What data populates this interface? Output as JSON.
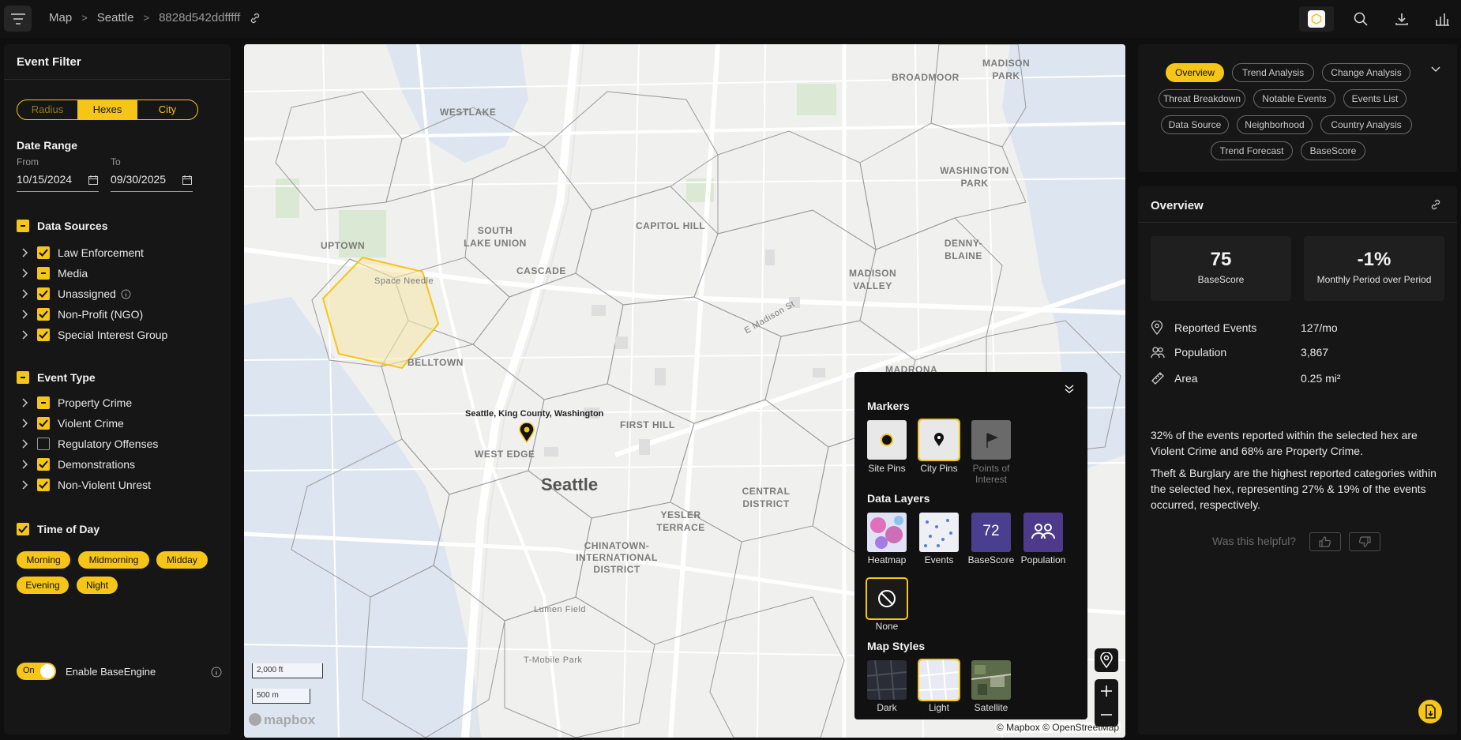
{
  "breadcrumb": {
    "items": [
      "Map",
      "Seattle",
      "8828d542ddfffff"
    ]
  },
  "colors": {
    "accent": "#f5c518",
    "panel": "#161616",
    "background": "#0f0f0f"
  },
  "icons": [
    "filter-icon",
    "link-icon",
    "hex-logo-icon",
    "search-icon",
    "download-icon",
    "chart-icon",
    "calendar-icon",
    "info-icon",
    "pin-icon",
    "zoom-in-icon",
    "zoom-out-icon",
    "export-icon"
  ],
  "event_filter": {
    "title": "Event Filter",
    "modes": [
      "Radius",
      "Hexes",
      "City"
    ],
    "selected_mode": "Hexes",
    "date_range": {
      "label": "Date Range",
      "from_label": "From",
      "from": "10/15/2024",
      "to_label": "To",
      "to": "09/30/2025"
    },
    "data_sources": {
      "label": "Data Sources",
      "items": [
        {
          "label": "Law Enforcement",
          "state": "checked"
        },
        {
          "label": "Media",
          "state": "partial"
        },
        {
          "label": "Unassigned",
          "state": "checked"
        },
        {
          "label": "Non-Profit (NGO)",
          "state": "checked"
        },
        {
          "label": "Special Interest Group",
          "state": "checked"
        }
      ]
    },
    "event_type": {
      "label": "Event Type",
      "items": [
        {
          "label": "Property Crime",
          "state": "partial"
        },
        {
          "label": "Violent Crime",
          "state": "checked"
        },
        {
          "label": "Regulatory Offenses",
          "state": "unchecked"
        },
        {
          "label": "Demonstrations",
          "state": "checked"
        },
        {
          "label": "Non-Violent Unrest",
          "state": "checked"
        }
      ]
    },
    "time_of_day": {
      "label": "Time of Day",
      "pills": [
        "Morning",
        "Midmorning",
        "Midday",
        "Evening",
        "Night"
      ]
    },
    "baseengine": {
      "toggle_text": "On",
      "label": "Enable BaseEngine"
    }
  },
  "map": {
    "place_labels": [
      "WESTLAKE",
      "SOUTH LAKE UNION",
      "UPTOWN",
      "CASCADE",
      "CAPITOL HILL",
      "BELLTOWN",
      "WEST EDGE",
      "FIRST HILL",
      "YESLER TERRACE",
      "CENTRAL DISTRICT",
      "CHINATOWN-INTERNATIONAL DISTRICT",
      "MADISON VALLEY",
      "DENNY-BLAINE",
      "WASHINGTON PARK",
      "BROADMOOR",
      "MADISON PARK",
      "MADRONA"
    ],
    "poi_labels": [
      "Space Needle",
      "Lumen Field",
      "T-Mobile Park",
      "E Madison St"
    ],
    "city_label": "Seattle",
    "pin_label": "Seattle, King County, Washington",
    "scale_ft": "2,000 ft",
    "scale_m": "500 m",
    "logo": "mapbox",
    "attribution": "© Mapbox © OpenStreetMap"
  },
  "layer_panel": {
    "markers": {
      "title": "Markers",
      "items": [
        "Site Pins",
        "City Pins",
        "Points of Interest"
      ],
      "selected": "City Pins"
    },
    "data_layers": {
      "title": "Data Layers",
      "items": [
        "Heatmap",
        "Events",
        "BaseScore",
        "Population",
        "None"
      ],
      "basescore_value": "72",
      "selected": "None"
    },
    "map_styles": {
      "title": "Map Styles",
      "items": [
        "Dark",
        "Light",
        "Satellite"
      ],
      "selected": "Light"
    }
  },
  "tabs": {
    "items": [
      "Overview",
      "Trend Analysis",
      "Change Analysis",
      "Threat Breakdown",
      "Notable Events",
      "Events List",
      "Data Source",
      "Neighborhood",
      "Country Analysis",
      "Trend Forecast",
      "BaseScore"
    ],
    "active": "Overview"
  },
  "overview": {
    "title": "Overview",
    "cards": [
      {
        "value": "75",
        "label": "BaseScore"
      },
      {
        "value": "-1%",
        "label": "Monthly Period over Period"
      }
    ],
    "stats": [
      {
        "icon": "location-icon",
        "label": "Reported Events",
        "value": "127/mo"
      },
      {
        "icon": "people-icon",
        "label": "Population",
        "value": "3,867"
      },
      {
        "icon": "ruler-icon",
        "label": "Area",
        "value": "0.25 mi²"
      }
    ],
    "paragraphs": [
      "32% of the events reported within the selected hex are Violent Crime and 68% are Property Crime.",
      "Theft & Burglary are the highest reported categories within the selected hex, representing 27% & 19% of the events occurred, respectively."
    ],
    "helpful_prompt": "Was this helpful?"
  }
}
